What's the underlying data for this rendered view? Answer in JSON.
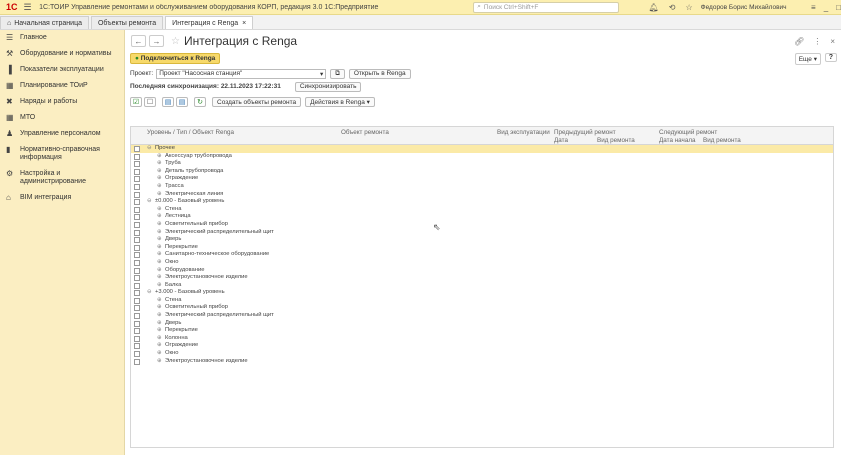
{
  "titlebar": {
    "logo": "1С",
    "title": "1С:ТОИР Управление ремонтами и обслуживанием оборудования КОРП, редакция 3.0 1С:Предприятие",
    "search_placeholder": "Поиск Ctrl+Shift+F",
    "user": "Федоров Борис Михайлович"
  },
  "tabs": [
    {
      "label": "Начальная страница"
    },
    {
      "label": "Объекты ремонта"
    },
    {
      "label": "Интеграция с Renga"
    }
  ],
  "sidebar": {
    "items": [
      {
        "label": "Главное",
        "icon": "menu-icon"
      },
      {
        "label": "Оборудование и нормативы",
        "icon": "equipment-icon"
      },
      {
        "label": "Показатели эксплуатации",
        "icon": "chart-icon"
      },
      {
        "label": "Планирование ТОиР",
        "icon": "calendar-icon"
      },
      {
        "label": "Наряды и работы",
        "icon": "tools-icon"
      },
      {
        "label": "МТО",
        "icon": "grid-icon"
      },
      {
        "label": "Управление персоналом",
        "icon": "person-icon"
      },
      {
        "label": "Нормативно-справочная информация",
        "icon": "book-icon"
      },
      {
        "label": "Настройка и администрирование",
        "icon": "gear-icon"
      },
      {
        "label": "BIM интеграция",
        "icon": "building-icon"
      }
    ]
  },
  "page": {
    "title": "Интеграция с Renga",
    "connect_label": "Подключиться к Renga",
    "more_label": "Еще",
    "help_label": "?",
    "project_label": "Проект:",
    "project_value": "Проект \"Насосная станция\"",
    "open_button": "Открыть в Renga",
    "sync_label": "Последняя синхронизация:",
    "sync_value": "22.11.2023 17:22:31",
    "sync_button": "Синхронизировать",
    "create_button": "Создать объекты ремонта",
    "actions_button": "Действия в Renga"
  },
  "table": {
    "headers": {
      "level": "Уровень / Тип / Объект Renga",
      "object": "Объект ремонта",
      "exploitation": "Вид эксплуатации",
      "prev": "Предыдущий ремонт",
      "prev_date": "Дата",
      "prev_type": "Вид ремонта",
      "next": "Следующий ремонт",
      "next_date": "Дата начала",
      "next_type": "Вид ремонта"
    },
    "rows": [
      {
        "label": "Прочее",
        "level": 0,
        "selected": true
      },
      {
        "label": "Аксессуар трубопровода",
        "level": 1
      },
      {
        "label": "Труба",
        "level": 1
      },
      {
        "label": "Деталь трубопровода",
        "level": 1
      },
      {
        "label": "Ограждение",
        "level": 1
      },
      {
        "label": "Трасса",
        "level": 1
      },
      {
        "label": "Электрическая линия",
        "level": 1
      },
      {
        "label": "±0.000 - Базовый уровень",
        "level": 0
      },
      {
        "label": "Стена",
        "level": 1
      },
      {
        "label": "Лестница",
        "level": 1
      },
      {
        "label": "Осветительный прибор",
        "level": 1
      },
      {
        "label": "Электрический распределительный щит",
        "level": 1
      },
      {
        "label": "Дверь",
        "level": 1
      },
      {
        "label": "Перекрытие",
        "level": 1
      },
      {
        "label": "Санитарно-техническое оборудование",
        "level": 1
      },
      {
        "label": "Окно",
        "level": 1
      },
      {
        "label": "Оборудование",
        "level": 1
      },
      {
        "label": "Электроустановочное изделие",
        "level": 1
      },
      {
        "label": "Балка",
        "level": 1
      },
      {
        "label": "+3.000 - Базовый уровень",
        "level": 0
      },
      {
        "label": "Стена",
        "level": 1
      },
      {
        "label": "Осветительный прибор",
        "level": 1
      },
      {
        "label": "Электрический распределительный щит",
        "level": 1
      },
      {
        "label": "Дверь",
        "level": 1
      },
      {
        "label": "Перекрытие",
        "level": 1
      },
      {
        "label": "Колонна",
        "level": 1
      },
      {
        "label": "Ограждение",
        "level": 1
      },
      {
        "label": "Окно",
        "level": 1
      },
      {
        "label": "Электроустановочное изделие",
        "level": 1
      }
    ]
  },
  "colors": {
    "sidebar_bg": "#fbeec2",
    "titlebar_bg": "#fcefb0",
    "selected_row": "#fbeaa7",
    "connect_button": "#f7d96a"
  }
}
